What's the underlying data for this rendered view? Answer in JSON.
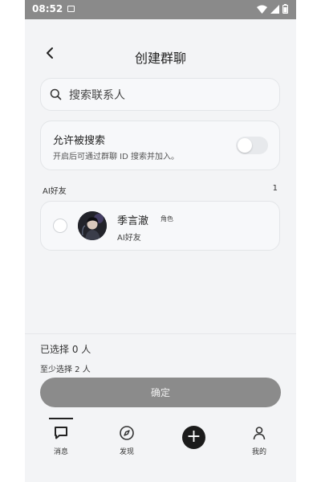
{
  "status_bar": {
    "time": "08:52",
    "icons": [
      "notification-icon",
      "wifi-icon",
      "signal-icon",
      "battery-icon"
    ]
  },
  "header": {
    "title": "创建群聊",
    "back_icon": "back-chevron-icon"
  },
  "search": {
    "placeholder": "搜索联系人",
    "value": ""
  },
  "permission": {
    "title": "允许被搜索",
    "description": "开启后可通过群聊 ID 搜索并加入。",
    "enabled": false
  },
  "section": {
    "label": "AI好友",
    "count": "1"
  },
  "contacts": [
    {
      "name": "季言澈",
      "tag": "角色",
      "subtitle": "AI好友",
      "selected": false
    }
  ],
  "footer": {
    "selected_text": "已选择 0 人",
    "min_text": "至少选择 2 人",
    "confirm_label": "确定"
  },
  "nav": {
    "items": [
      {
        "label": "消息",
        "icon": "message-icon",
        "active": true
      },
      {
        "label": "发现",
        "icon": "compass-icon",
        "active": false
      },
      {
        "label": "",
        "icon": "plus-icon",
        "active": false
      },
      {
        "label": "我的",
        "icon": "profile-icon",
        "active": false
      }
    ]
  },
  "colors": {
    "accent_dark": "#1b1b1b",
    "button_disabled": "#8b8b8b",
    "background": "#f3f4f6"
  }
}
